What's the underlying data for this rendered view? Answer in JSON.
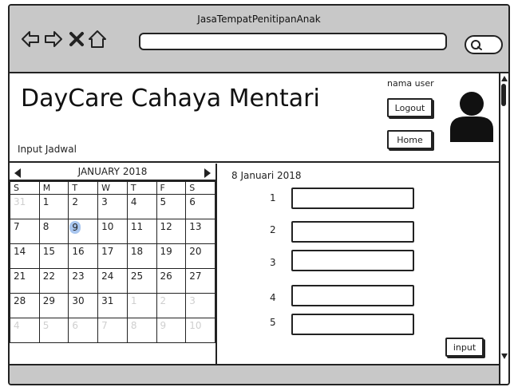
{
  "window": {
    "title": "JasaTempatPenitipanAnak"
  },
  "nav": {
    "back_icon": "back-arrow-icon",
    "forward_icon": "forward-arrow-icon",
    "close_icon": "close-x-icon",
    "home_icon": "home-icon",
    "search_icon": "search-icon",
    "address_value": ""
  },
  "header": {
    "title": "DayCare Cahaya Mentari",
    "section_label": "Input Jadwal",
    "username": "nama user",
    "logout_label": "Logout",
    "home_label": "Home",
    "avatar_icon": "user-avatar-icon"
  },
  "calendar": {
    "month_label": "JANUARY 2018",
    "weekdays": [
      "S",
      "M",
      "T",
      "W",
      "T",
      "F",
      "S"
    ],
    "weeks": [
      [
        "31",
        "1",
        "2",
        "3",
        "4",
        "5",
        "6"
      ],
      [
        "7",
        "8",
        "9",
        "10",
        "11",
        "12",
        "13"
      ],
      [
        "14",
        "15",
        "16",
        "17",
        "18",
        "19",
        "20"
      ],
      [
        "21",
        "22",
        "23",
        "24",
        "25",
        "26",
        "27"
      ],
      [
        "28",
        "29",
        "30",
        "31",
        "1",
        "2",
        "3"
      ],
      [
        "4",
        "5",
        "6",
        "7",
        "8",
        "9",
        "10"
      ]
    ],
    "selected_day": "9",
    "highlight_color": "#a9c6ef"
  },
  "form": {
    "date_label": "8 Januari 2018",
    "rows": [
      {
        "label": "1",
        "value": ""
      },
      {
        "label": "2",
        "value": ""
      },
      {
        "label": "3",
        "value": ""
      },
      {
        "label": "4",
        "value": ""
      },
      {
        "label": "5",
        "value": ""
      }
    ],
    "submit_label": "input"
  },
  "colors": {
    "chrome": "#c8c8c8",
    "stroke": "#222222"
  }
}
